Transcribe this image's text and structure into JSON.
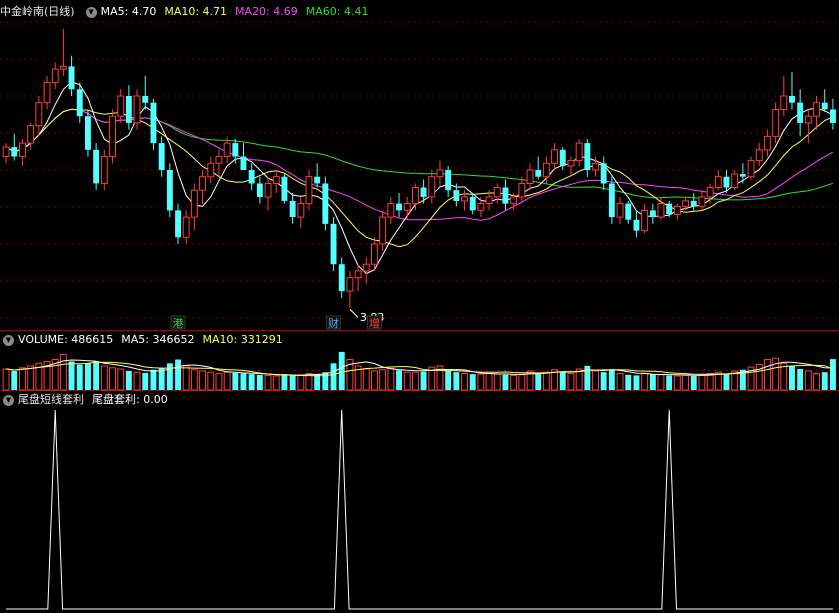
{
  "title": "中金岭南",
  "period": "(日线)",
  "colors": {
    "up": "#ff3c3c",
    "down": "#54ffff",
    "ma5": "#ffffff",
    "ma10": "#ffff55",
    "ma20": "#ff44ff",
    "ma60": "#33dd33",
    "grid": "#7a0000",
    "divider": "#aa0000"
  },
  "legend": {
    "k": {
      "ma5_label": "MA5:",
      "ma5_value": "4.70",
      "ma10_label": "MA10:",
      "ma10_value": "4.71",
      "ma20_label": "MA20:",
      "ma20_value": "4.69",
      "ma60_label": "MA60:",
      "ma60_value": "4.41"
    },
    "volume": {
      "vol_label": "VOLUME:",
      "vol_value": "486615",
      "ma5_label": "MA5:",
      "ma5_value": "346652",
      "ma10_label": "MA10:",
      "ma10_value": "331291"
    },
    "indicator": {
      "name": "尾盘短线套利",
      "line_label": "尾盘套利:",
      "line_value": "0.00"
    }
  },
  "markers": [
    {
      "text": "港",
      "index": 21,
      "color": "#33cc33"
    },
    {
      "text": "财",
      "index": 40,
      "color": "#4da6ff"
    },
    {
      "text": "增",
      "index": 45,
      "color": "#ff3c3c"
    }
  ],
  "annotation": {
    "text": "3.83",
    "index": 42,
    "price": 3.83
  },
  "chart_data": {
    "type": "candlestick",
    "price_range": [
      3.75,
      5.95
    ],
    "volume_range": [
      0,
      630000
    ],
    "indicator_range": [
      0,
      1
    ],
    "candles": [
      [
        4.95,
        5.05,
        4.9,
        5.02
      ],
      [
        5.02,
        5.12,
        4.92,
        4.95
      ],
      [
        4.95,
        5.08,
        4.88,
        5.05
      ],
      [
        5.05,
        5.2,
        5.0,
        5.18
      ],
      [
        5.18,
        5.4,
        5.1,
        5.35
      ],
      [
        5.35,
        5.55,
        5.3,
        5.5
      ],
      [
        5.5,
        5.65,
        5.45,
        5.6
      ],
      [
        5.6,
        5.9,
        5.55,
        5.62
      ],
      [
        5.62,
        5.7,
        5.4,
        5.45
      ],
      [
        5.45,
        5.5,
        5.2,
        5.25
      ],
      [
        5.25,
        5.3,
        4.95,
        5.0
      ],
      [
        5.0,
        5.05,
        4.7,
        4.75
      ],
      [
        4.75,
        5.0,
        4.7,
        4.95
      ],
      [
        4.95,
        5.3,
        4.9,
        5.25
      ],
      [
        5.25,
        5.45,
        5.2,
        5.4
      ],
      [
        5.4,
        5.48,
        5.15,
        5.2
      ],
      [
        5.2,
        5.45,
        5.15,
        5.4
      ],
      [
        5.4,
        5.55,
        5.3,
        5.35
      ],
      [
        5.35,
        5.38,
        5.0,
        5.05
      ],
      [
        5.05,
        5.1,
        4.8,
        4.85
      ],
      [
        4.85,
        4.9,
        4.5,
        4.55
      ],
      [
        4.55,
        4.6,
        4.3,
        4.35
      ],
      [
        4.35,
        4.55,
        4.3,
        4.5
      ],
      [
        4.5,
        4.75,
        4.4,
        4.7
      ],
      [
        4.7,
        4.85,
        4.6,
        4.8
      ],
      [
        4.8,
        4.95,
        4.75,
        4.9
      ],
      [
        4.9,
        5.0,
        4.8,
        4.95
      ],
      [
        4.95,
        5.1,
        4.9,
        5.05
      ],
      [
        5.05,
        5.08,
        4.9,
        4.95
      ],
      [
        4.95,
        5.05,
        4.85,
        4.85
      ],
      [
        4.85,
        4.9,
        4.7,
        4.75
      ],
      [
        4.75,
        4.8,
        4.6,
        4.65
      ],
      [
        4.65,
        4.8,
        4.55,
        4.75
      ],
      [
        4.75,
        4.85,
        4.68,
        4.8
      ],
      [
        4.8,
        4.82,
        4.6,
        4.62
      ],
      [
        4.62,
        4.68,
        4.45,
        4.5
      ],
      [
        4.5,
        4.65,
        4.42,
        4.6
      ],
      [
        4.6,
        4.85,
        4.55,
        4.8
      ],
      [
        4.8,
        4.9,
        4.72,
        4.75
      ],
      [
        4.75,
        4.8,
        4.4,
        4.45
      ],
      [
        4.45,
        4.5,
        4.1,
        4.15
      ],
      [
        4.15,
        4.2,
        3.9,
        3.95
      ],
      [
        3.95,
        4.1,
        3.83,
        4.05
      ],
      [
        4.05,
        4.15,
        3.95,
        4.1
      ],
      [
        4.1,
        4.2,
        4.0,
        4.15
      ],
      [
        4.15,
        4.35,
        4.1,
        4.3
      ],
      [
        4.3,
        4.55,
        4.25,
        4.5
      ],
      [
        4.5,
        4.65,
        4.45,
        4.6
      ],
      [
        4.6,
        4.68,
        4.5,
        4.55
      ],
      [
        4.55,
        4.65,
        4.48,
        4.6
      ],
      [
        4.6,
        4.75,
        4.55,
        4.72
      ],
      [
        4.72,
        4.78,
        4.6,
        4.65
      ],
      [
        4.65,
        4.85,
        4.6,
        4.8
      ],
      [
        4.8,
        4.92,
        4.72,
        4.85
      ],
      [
        4.85,
        4.88,
        4.65,
        4.7
      ],
      [
        4.7,
        4.75,
        4.58,
        4.62
      ],
      [
        4.62,
        4.7,
        4.55,
        4.65
      ],
      [
        4.65,
        4.68,
        4.52,
        4.55
      ],
      [
        4.55,
        4.65,
        4.5,
        4.6
      ],
      [
        4.6,
        4.7,
        4.55,
        4.65
      ],
      [
        4.65,
        4.75,
        4.6,
        4.72
      ],
      [
        4.72,
        4.78,
        4.55,
        4.6
      ],
      [
        4.6,
        4.68,
        4.55,
        4.65
      ],
      [
        4.65,
        4.8,
        4.6,
        4.75
      ],
      [
        4.75,
        4.9,
        4.7,
        4.85
      ],
      [
        4.85,
        4.95,
        4.78,
        4.8
      ],
      [
        4.8,
        4.95,
        4.75,
        4.9
      ],
      [
        4.9,
        5.05,
        4.85,
        5.0
      ],
      [
        5.0,
        5.02,
        4.85,
        4.88
      ],
      [
        4.88,
        4.95,
        4.82,
        4.92
      ],
      [
        4.92,
        5.08,
        4.88,
        5.05
      ],
      [
        5.05,
        5.08,
        4.8,
        4.85
      ],
      [
        4.85,
        4.95,
        4.8,
        4.9
      ],
      [
        4.9,
        4.95,
        4.7,
        4.75
      ],
      [
        4.75,
        4.8,
        4.45,
        4.5
      ],
      [
        4.5,
        4.65,
        4.45,
        4.6
      ],
      [
        4.6,
        4.62,
        4.45,
        4.48
      ],
      [
        4.48,
        4.55,
        4.35,
        4.4
      ],
      [
        4.4,
        4.6,
        4.38,
        4.55
      ],
      [
        4.55,
        4.6,
        4.45,
        4.5
      ],
      [
        4.5,
        4.65,
        4.48,
        4.6
      ],
      [
        4.6,
        4.62,
        4.5,
        4.52
      ],
      [
        4.52,
        4.6,
        4.48,
        4.58
      ],
      [
        4.58,
        4.65,
        4.55,
        4.62
      ],
      [
        4.62,
        4.68,
        4.55,
        4.58
      ],
      [
        4.58,
        4.7,
        4.55,
        4.65
      ],
      [
        4.65,
        4.75,
        4.6,
        4.72
      ],
      [
        4.72,
        4.85,
        4.7,
        4.8
      ],
      [
        4.8,
        4.85,
        4.68,
        4.72
      ],
      [
        4.72,
        4.85,
        4.7,
        4.82
      ],
      [
        4.82,
        4.9,
        4.75,
        4.8
      ],
      [
        4.8,
        4.95,
        4.78,
        4.92
      ],
      [
        4.92,
        5.05,
        4.88,
        5.0
      ],
      [
        5.0,
        5.15,
        4.95,
        5.1
      ],
      [
        5.1,
        5.35,
        5.05,
        5.3
      ],
      [
        5.3,
        5.55,
        5.25,
        5.4
      ],
      [
        5.4,
        5.58,
        5.3,
        5.35
      ],
      [
        5.35,
        5.45,
        5.1,
        5.2
      ],
      [
        5.2,
        5.3,
        5.05,
        5.25
      ],
      [
        5.25,
        5.4,
        5.15,
        5.35
      ],
      [
        5.35,
        5.45,
        5.28,
        5.3
      ],
      [
        5.3,
        5.38,
        5.15,
        5.2
      ]
    ],
    "volume": [
      330000,
      300000,
      350000,
      380000,
      420000,
      450000,
      480000,
      560000,
      450000,
      400000,
      420000,
      450000,
      380000,
      350000,
      330000,
      300000,
      280000,
      270000,
      320000,
      350000,
      420000,
      480000,
      380000,
      320000,
      300000,
      280000,
      260000,
      280000,
      270000,
      260000,
      250000,
      240000,
      230000,
      220000,
      250000,
      240000,
      230000,
      260000,
      250000,
      280000,
      420000,
      600000,
      480000,
      380000,
      330000,
      300000,
      320000,
      340000,
      310000,
      280000,
      280000,
      290000,
      360000,
      380000,
      300000,
      280000,
      260000,
      250000,
      250000,
      260000,
      250000,
      240000,
      230000,
      240000,
      300000,
      260000,
      280000,
      320000,
      290000,
      260000,
      330000,
      380000,
      300000,
      280000,
      320000,
      260000,
      240000,
      230000,
      260000,
      250000,
      240000,
      230000,
      220000,
      230000,
      220000,
      240000,
      260000,
      280000,
      250000,
      300000,
      320000,
      360000,
      400000,
      480000,
      500000,
      420000,
      380000,
      330000,
      300000,
      260000,
      280000,
      486615
    ],
    "vol_ma5": [
      330000,
      315000,
      327000,
      340000,
      356000,
      380000,
      416000,
      458000,
      472000,
      468000,
      462000,
      454000,
      420000,
      404000,
      386000,
      362000,
      331000,
      305000,
      300000,
      304000,
      328000,
      368000,
      390000,
      394000,
      380000,
      356000,
      312000,
      288000,
      278000,
      270000,
      264000,
      260000,
      252000,
      244000,
      239000,
      237000,
      235000,
      240000,
      246000,
      252000,
      286000,
      356000,
      406000,
      426000,
      442000,
      418000,
      362000,
      334000,
      322000,
      310000,
      306000,
      304000,
      312000,
      326000,
      322000,
      322000,
      316000,
      290000,
      268000,
      260000,
      254000,
      252000,
      246000,
      245000,
      253000,
      255000,
      266000,
      280000,
      290000,
      286000,
      296000,
      316000,
      314000,
      306000,
      322000,
      308000,
      288000,
      266000,
      262000,
      248000,
      244000,
      242000,
      240000,
      236000,
      232000,
      230000,
      234000,
      246000,
      250000,
      266000,
      282000,
      302000,
      326000,
      372000,
      412000,
      436000,
      436000,
      422000,
      406000,
      378000,
      350000,
      346652
    ],
    "vol_ma10": [
      330000,
      315000,
      327000,
      340000,
      356000,
      368000,
      383000,
      405000,
      414000,
      413000,
      421000,
      435000,
      438000,
      435000,
      426000,
      411000,
      391000,
      362000,
      351000,
      345000,
      345000,
      348000,
      348000,
      345000,
      342000,
      340000,
      331000,
      322000,
      317000,
      307000,
      290000,
      266000,
      251000,
      241000,
      236000,
      232000,
      229000,
      227000,
      225000,
      227000,
      244000,
      280000,
      306000,
      322000,
      339000,
      345000,
      354000,
      362000,
      368000,
      368000,
      354000,
      323000,
      308000,
      308000,
      305000,
      302000,
      297000,
      288000,
      282000,
      280000,
      278000,
      283000,
      276000,
      271000,
      272000,
      269000,
      272000,
      279000,
      283000,
      282000,
      290000,
      306000,
      313000,
      317000,
      319000,
      319000,
      315000,
      301000,
      298000,
      296000,
      287000,
      272000,
      264000,
      259000,
      249000,
      247000,
      249000,
      254000,
      253000,
      258000,
      266000,
      279000,
      297000,
      322000,
      350000,
      368000,
      380000,
      385000,
      391000,
      387000,
      383000,
      331291
    ],
    "indicator": [
      0,
      0,
      0,
      0,
      0,
      0,
      1,
      0,
      0,
      0,
      0,
      0,
      0,
      0,
      0,
      0,
      0,
      0,
      0,
      0,
      0,
      0,
      0,
      0,
      0,
      0,
      0,
      0,
      0,
      0,
      0,
      0,
      0,
      0,
      0,
      0,
      0,
      0,
      0,
      0,
      0,
      1,
      0,
      0,
      0,
      0,
      0,
      0,
      0,
      0,
      0,
      0,
      0,
      0,
      0,
      0,
      0,
      0,
      0,
      0,
      0,
      0,
      0,
      0,
      0,
      0,
      0,
      0,
      0,
      0,
      0,
      0,
      0,
      0,
      0,
      0,
      0,
      0,
      0,
      0,
      0,
      1,
      0,
      0,
      0,
      0,
      0,
      0,
      0,
      0,
      0,
      0,
      0,
      0,
      0,
      0,
      0,
      0,
      0,
      0,
      0,
      0
    ]
  }
}
